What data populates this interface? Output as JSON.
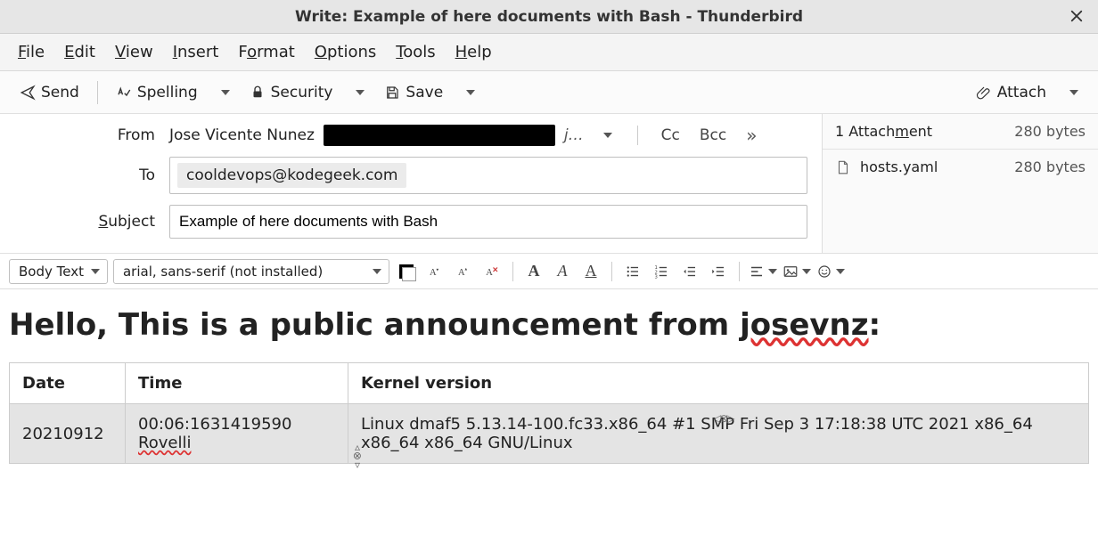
{
  "window": {
    "title": "Write: Example of here documents with Bash - Thunderbird"
  },
  "menu": {
    "file": {
      "accel": "F",
      "rest": "ile"
    },
    "edit": {
      "accel": "E",
      "rest": "dit"
    },
    "view": {
      "accel": "V",
      "rest": "iew"
    },
    "insert": {
      "accel": "I",
      "rest": "nsert"
    },
    "format": {
      "pre": "F",
      "accel": "o",
      "rest": "rmat"
    },
    "options": {
      "accel": "O",
      "rest": "ptions"
    },
    "tools": {
      "accel": "T",
      "rest": "ools"
    },
    "help": {
      "accel": "H",
      "rest": "elp"
    }
  },
  "toolbar": {
    "send": "Send",
    "spelling": "Spelling",
    "security": "Security",
    "save": "Save",
    "attach": "Attach"
  },
  "compose": {
    "from_label": "From",
    "from_name": "Jose Vicente Nunez",
    "from_addr_abbrev": "j…",
    "cc": "Cc",
    "bcc": "Bcc",
    "to_label": "To",
    "to_pill": "cooldevops@kodegeek.com",
    "subject_label_accel": "S",
    "subject_label_rest": "ubject",
    "subject_value": "Example of here documents with Bash"
  },
  "attachments": {
    "header_count_text": "1 Attach",
    "header_accel": "m",
    "header_rest": "ent",
    "total_size": "280 bytes",
    "items": [
      {
        "name": "hosts.yaml",
        "size": "280 bytes"
      }
    ]
  },
  "formatbar": {
    "paragraph_style": "Body Text",
    "font_family": "arial, sans-serif (not installed)"
  },
  "body": {
    "heading_pre": "Hello, This is a public announcement from ",
    "heading_user": "josevnz",
    "heading_post": ":",
    "table": {
      "headers": {
        "date": "Date",
        "time": "Time",
        "kernel": "Kernel version"
      },
      "row": {
        "date": "20210912",
        "time_line1": "00:06:1631419590",
        "time_line2": "Rovelli",
        "kernel": "Linux dmaf5 5.13.14-100.fc33.x86_64 #1 SMP Fri Sep 3 17:18:38 UTC 2021 x86_64 x86_64 x86_64 GNU/Linux"
      }
    }
  }
}
